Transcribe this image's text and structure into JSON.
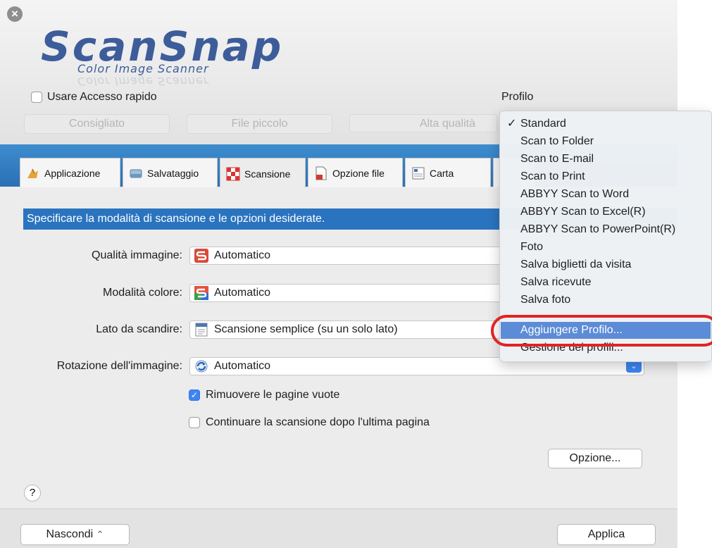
{
  "logo": {
    "main": "ScanSnap",
    "sub": "Color Image Scanner"
  },
  "header": {
    "quick_access_label": "Usare Accesso rapido",
    "quick_access_checked": false,
    "presets": [
      "Consigliato",
      "File piccolo",
      "Alta qualità"
    ],
    "profile_label": "Profilo"
  },
  "tabs": [
    {
      "label": "Applicazione",
      "icon": "application-icon"
    },
    {
      "label": "Salvataggio",
      "icon": "save-icon"
    },
    {
      "label": "Scansione",
      "icon": "scan-icon",
      "active": true
    },
    {
      "label": "Opzione file",
      "icon": "file-option-icon"
    },
    {
      "label": "Carta",
      "icon": "paper-icon"
    }
  ],
  "scan_panel": {
    "banner": "Specificare la modalità di scansione e le opzioni desiderate.",
    "fields": [
      {
        "label": "Qualità immagine:",
        "value": "Automatico",
        "icon": "scansnap-auto-icon"
      },
      {
        "label": "Modalità colore:",
        "value": "Automatico",
        "icon": "scansnap-color-icon"
      },
      {
        "label": "Lato da scandire:",
        "value": "Scansione semplice (su un solo lato)",
        "icon": "single-side-icon"
      },
      {
        "label": "Rotazione dell'immagine:",
        "value": "Automatico",
        "icon": "rotate-icon"
      }
    ],
    "remove_blank": {
      "label": "Rimuovere le pagine vuote",
      "checked": true
    },
    "continue_scan": {
      "label": "Continuare la scansione dopo l'ultima pagina",
      "checked": false
    },
    "option_button": "Opzione..."
  },
  "help_label": "?",
  "footer": {
    "hide_button": "Nascondi",
    "apply_button": "Applica"
  },
  "profile_menu": {
    "items": [
      "Standard",
      "Scan to Folder",
      "Scan to E-mail",
      "Scan to Print",
      "ABBYY Scan to Word",
      "ABBYY Scan to Excel(R)",
      "ABBYY Scan to PowerPoint(R)",
      "Foto",
      "Salva biglietti da visita",
      "Salva ricevute",
      "Salva foto"
    ],
    "checked_item": "Standard",
    "check_mark": "✓",
    "add_profile": "Aggiungere Profilo...",
    "manage_profiles": "Gestione dei profili..."
  },
  "colors": {
    "accent_blue": "#2a74bf",
    "highlight": "#5c8bd7",
    "callout_red": "#e02424"
  }
}
